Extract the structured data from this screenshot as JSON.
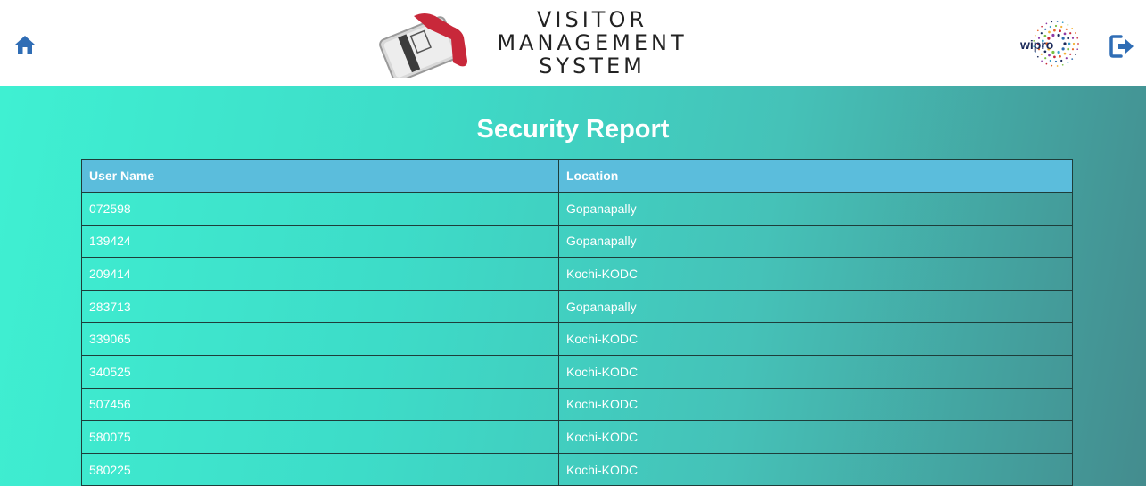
{
  "header": {
    "home_icon": "home-icon",
    "logo_lines": [
      "VISITOR",
      "MANAGEMENT",
      "SYSTEM"
    ],
    "partner_logo_text": "wipro",
    "logout_icon": "logout-icon"
  },
  "page": {
    "title": "Security Report"
  },
  "table": {
    "columns": [
      "User Name",
      "Location"
    ],
    "rows": [
      {
        "user": "072598",
        "location": "Gopanapally"
      },
      {
        "user": "139424",
        "location": "Gopanapally"
      },
      {
        "user": "209414",
        "location": "Kochi-KODC"
      },
      {
        "user": "283713",
        "location": "Gopanapally"
      },
      {
        "user": "339065",
        "location": "Kochi-KODC"
      },
      {
        "user": "340525",
        "location": "Kochi-KODC"
      },
      {
        "user": "507456",
        "location": "Kochi-KODC"
      },
      {
        "user": "580075",
        "location": "Kochi-KODC"
      },
      {
        "user": "580225",
        "location": "Kochi-KODC"
      }
    ]
  },
  "colors": {
    "header_bg": "#ffffff",
    "icon_blue": "#2f6db5",
    "table_header_bg": "#5bbddc",
    "gradient_start": "#3ff0d2",
    "gradient_end": "#448c8e"
  }
}
